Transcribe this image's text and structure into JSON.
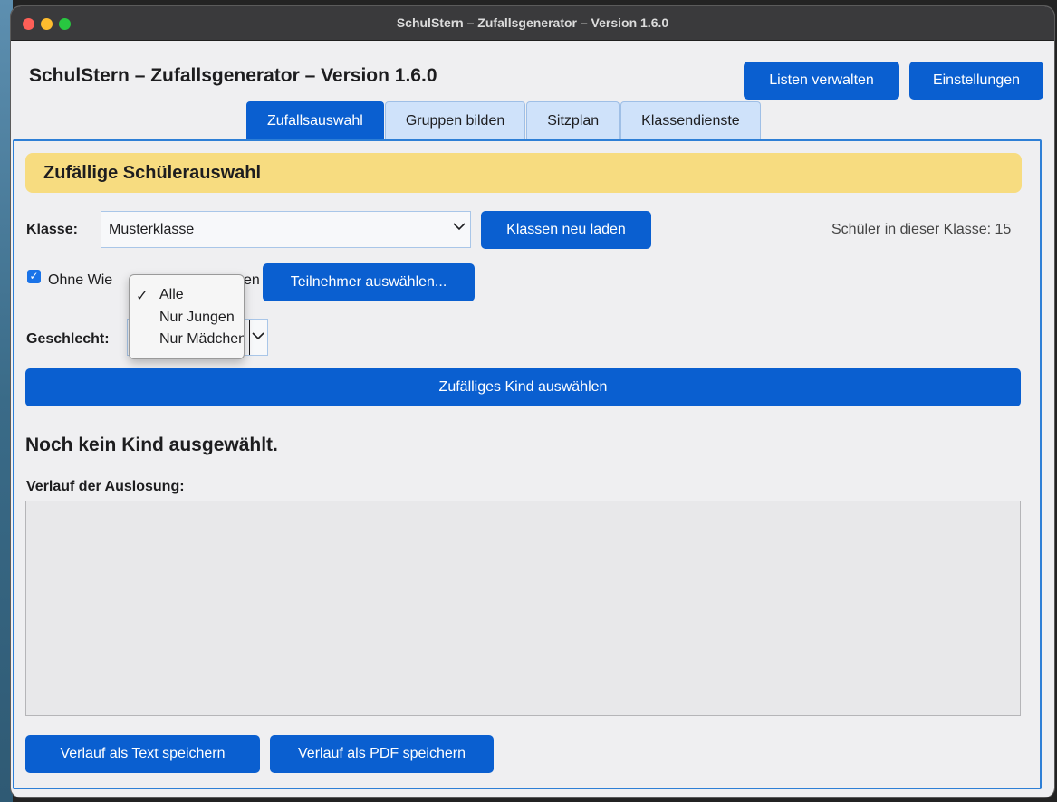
{
  "window": {
    "title": "SchulStern – Zufallsgenerator – Version 1.6.0"
  },
  "header": {
    "app_title": "SchulStern – Zufallsgenerator – Version 1.6.0",
    "manage_lists_label": "Listen verwalten",
    "settings_label": "Einstellungen"
  },
  "tabs": [
    {
      "label": "Zufallsauswahl",
      "active": true
    },
    {
      "label": "Gruppen bilden",
      "active": false
    },
    {
      "label": "Sitzplan",
      "active": false
    },
    {
      "label": "Klassendienste",
      "active": false
    }
  ],
  "random_pick": {
    "section_title": "Zufällige Schülerauswahl",
    "class_label": "Klasse:",
    "class_selected": "Musterklasse",
    "reload_classes_label": "Klassen neu laden",
    "student_count_text": "Schüler in dieser Klasse: 15",
    "no_repeat_label_visible_start": "Ohne Wie",
    "no_repeat_label_visible_end": "en",
    "no_repeat_checked": true,
    "select_participants_label": "Teilnehmer auswählen...",
    "gender_label": "Geschlecht:",
    "gender_options": [
      "Alle",
      "Nur Jungen",
      "Nur Mädchen"
    ],
    "gender_selected": "Alle",
    "pick_button_label": "Zufälliges Kind auswählen",
    "status_text": "Noch kein Kind ausgewählt.",
    "history_label": "Verlauf der Auslosung:",
    "save_text_label": "Verlauf als Text speichern",
    "save_pdf_label": "Verlauf als PDF speichern"
  },
  "colors": {
    "accent": "#0a5fd0",
    "section_bg": "#f7dc80",
    "tab_inactive": "#cfe2fa"
  }
}
